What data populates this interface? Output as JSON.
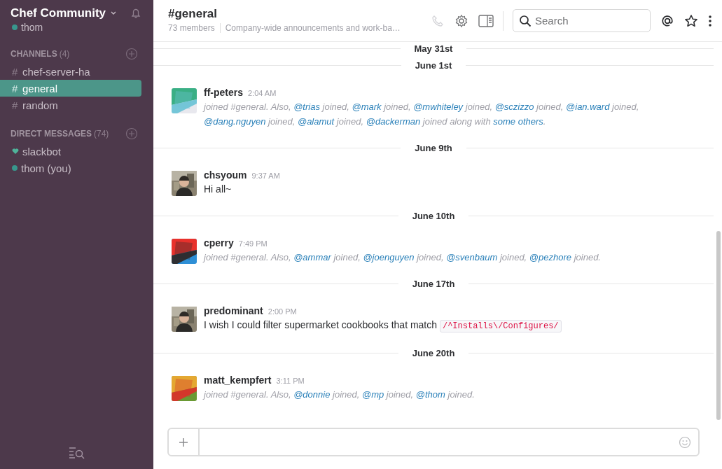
{
  "sidebar": {
    "team": "Chef Community",
    "user": {
      "name": "thom",
      "online": true
    },
    "sections": [
      {
        "kind": "channels",
        "title": "CHANNELS",
        "count": "(4)",
        "items": [
          {
            "symbol": "#",
            "name": "chef-server-ha",
            "selected": false
          },
          {
            "symbol": "#",
            "name": "general",
            "selected": true
          },
          {
            "symbol": "#",
            "name": "random",
            "selected": false
          }
        ]
      },
      {
        "kind": "direct",
        "title": "DIRECT MESSAGES",
        "count": "(74)",
        "items": [
          {
            "kind": "bot",
            "name": "slackbot",
            "selected": false
          },
          {
            "kind": "user",
            "name": "thom (you)",
            "online": true,
            "selected": false
          }
        ]
      }
    ]
  },
  "header": {
    "title": "#general",
    "members": "73 members",
    "purpose": "Company-wide announcements and work-ba…",
    "search": {
      "placeholder": "Search"
    },
    "call_disabled": true
  },
  "messages": [
    {
      "kind": "day",
      "label": "May 31st"
    },
    {
      "kind": "day",
      "label": "June 1st"
    },
    {
      "kind": "join",
      "author": "ff-peters",
      "time": "2:04 AM",
      "avatar": {
        "kind": "green-pattern"
      },
      "segments": [
        {
          "kind": "plain",
          "text": "joined #general. Also, "
        },
        {
          "kind": "mention",
          "text": "@trias"
        },
        {
          "kind": "plain",
          "text": " joined, "
        },
        {
          "kind": "mention",
          "text": "@mark"
        },
        {
          "kind": "plain",
          "text": " joined, "
        },
        {
          "kind": "mention",
          "text": "@mwhiteley"
        },
        {
          "kind": "plain",
          "text": " joined, "
        },
        {
          "kind": "mention",
          "text": "@sczizzo"
        },
        {
          "kind": "plain",
          "text": " joined, "
        },
        {
          "kind": "mention",
          "text": "@ian.ward"
        },
        {
          "kind": "plain",
          "text": " joined, "
        },
        {
          "kind": "mention",
          "text": "@dang.nguyen"
        },
        {
          "kind": "plain",
          "text": " joined, "
        },
        {
          "kind": "mention",
          "text": "@alamut"
        },
        {
          "kind": "plain",
          "text": " joined, "
        },
        {
          "kind": "mention",
          "text": "@dackerman"
        },
        {
          "kind": "plain",
          "text": " joined along with "
        },
        {
          "kind": "mention",
          "text": "some others"
        },
        {
          "kind": "plain",
          "text": "."
        }
      ]
    },
    {
      "kind": "day",
      "label": "June 9th"
    },
    {
      "kind": "post",
      "author": "chsyoum",
      "time": "9:37 AM",
      "avatar": {
        "kind": "picture"
      },
      "segments": [
        {
          "kind": "plain",
          "text": "Hi all~"
        }
      ]
    },
    {
      "kind": "day",
      "label": "June 10th"
    },
    {
      "kind": "join",
      "author": "cperry",
      "time": "7:49 PM",
      "avatar": {
        "kind": "red-pattern"
      },
      "segments": [
        {
          "kind": "plain",
          "text": "joined #general. Also, "
        },
        {
          "kind": "mention",
          "text": "@ammar"
        },
        {
          "kind": "plain",
          "text": " joined, "
        },
        {
          "kind": "mention",
          "text": "@joenguyen"
        },
        {
          "kind": "plain",
          "text": " joined, "
        },
        {
          "kind": "mention",
          "text": "@svenbaum"
        },
        {
          "kind": "plain",
          "text": " joined, "
        },
        {
          "kind": "mention",
          "text": "@pezhore"
        },
        {
          "kind": "plain",
          "text": " joined."
        }
      ]
    },
    {
      "kind": "day",
      "label": "June 17th"
    },
    {
      "kind": "post",
      "author": "predominant",
      "time": "2:00 PM",
      "avatar": {
        "kind": "picture"
      },
      "segments": [
        {
          "kind": "plain",
          "text": "I wish I could filter supermarket cookbooks that match "
        },
        {
          "kind": "code",
          "text": "/^Installs\\/Configures/"
        }
      ]
    },
    {
      "kind": "day",
      "label": "June 20th"
    },
    {
      "kind": "join",
      "author": "matt_kempfert",
      "time": "3:11 PM",
      "avatar": {
        "kind": "yellow-pattern"
      },
      "segments": [
        {
          "kind": "plain",
          "text": "joined #general. Also, "
        },
        {
          "kind": "mention",
          "text": "@donnie"
        },
        {
          "kind": "plain",
          "text": " joined, "
        },
        {
          "kind": "mention",
          "text": "@mp"
        },
        {
          "kind": "plain",
          "text": " joined, "
        },
        {
          "kind": "mention",
          "text": "@thom"
        },
        {
          "kind": "plain",
          "text": " joined."
        }
      ]
    }
  ]
}
